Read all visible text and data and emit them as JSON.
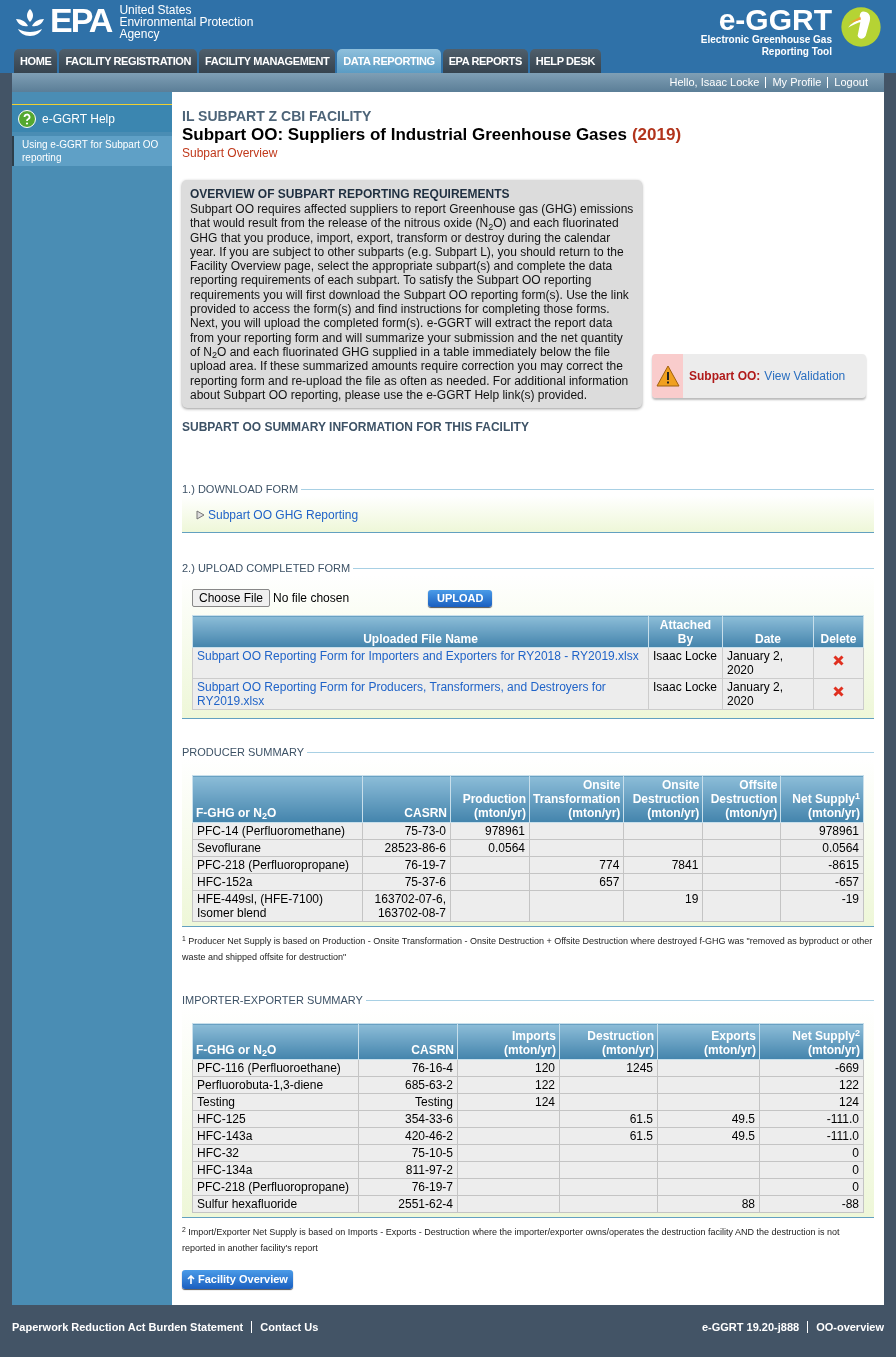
{
  "header": {
    "agency_logo": "EPA",
    "agency_name": [
      "United States",
      "Environmental Protection",
      "Agency"
    ],
    "app_logo": "e-GGRT",
    "app_name": "Electronic Greenhouse Gas Reporting Tool"
  },
  "nav_tabs": [
    {
      "label": "HOME",
      "selected": false
    },
    {
      "label": "FACILITY REGISTRATION",
      "selected": false
    },
    {
      "label": "FACILITY MANAGEMENT",
      "selected": false
    },
    {
      "label": "DATA REPORTING",
      "selected": true
    },
    {
      "label": "EPA REPORTS",
      "selected": false
    },
    {
      "label": "HELP DESK",
      "selected": false
    }
  ],
  "user_links": [
    "Hello, Isaac Locke",
    "My Profile",
    "Logout"
  ],
  "sidebar": {
    "help_title": "e-GGRT Help",
    "items": [
      "Using e-GGRT for Subpart OO reporting"
    ]
  },
  "page": {
    "facility": "IL SUBPART Z CBI FACILITY",
    "title": "Subpart OO: Suppliers of Industrial Greenhouse Gases",
    "year": "(2019)",
    "subtitle": "Subpart Overview"
  },
  "overview": {
    "title": "OVERVIEW OF SUBPART REPORTING REQUIREMENTS",
    "text": "Subpart OO requires affected suppliers to report Greenhouse gas (GHG) emissions that would result from the release of the nitrous oxide (N$_{2}$O) and each fluorinated GHG that you produce, import, export, transform or destroy during the calendar year. If you are subject to other subparts (e.g. Subpart L), you should return to the Facility Overview page, select the appropriate subpart(s) and complete the data reporting requirements of each subpart. To satisfy the Subpart OO reporting requirements you will first download the Subpart OO reporting form(s). Use the link provided to access the form(s) and find instructions for completing those forms. Next, you will upload the completed form(s). e-GGRT will extract the report data from your reporting form and will summarize your submission and the net quantity of N$_{2}$O and each fluorinated GHG supplied in a table immediately below the file upload area. If these summarized amounts require correction you may correct the reporting form and re-upload the file as often as needed. For additional information about Subpart OO reporting, please use the e-GGRT Help link(s) provided."
  },
  "validation": {
    "label": "Subpart OO:",
    "link": "View Validation"
  },
  "summary_heading": "SUBPART OO SUMMARY INFORMATION FOR THIS FACILITY",
  "download": {
    "legend": "1.) DOWNLOAD FORM",
    "link": "Subpart OO GHG Reporting"
  },
  "upload": {
    "legend": "2.) UPLOAD COMPLETED FORM",
    "choose_button": "Choose File",
    "file_status": "No file chosen",
    "upload_button": "UPLOAD",
    "columns": [
      "Uploaded File Name",
      "Attached By",
      "Date",
      "Delete"
    ],
    "rows": [
      {
        "file": "Subpart OO Reporting Form for Importers and Exporters for RY2018 - RY2019.xlsx",
        "attached_by": "Isaac Locke",
        "date": "January 2, 2020"
      },
      {
        "file": "Subpart OO Reporting Form for Producers, Transformers, and Destroyers for RY2019.xlsx",
        "attached_by": "Isaac Locke",
        "date": "January 2, 2020"
      }
    ]
  },
  "producer_summary": {
    "legend": "PRODUCER SUMMARY",
    "columns": [
      "F-GHG or N$_{2}$O",
      "CASRN",
      "Production (mton/yr)",
      "Onsite Transformation (mton/yr)",
      "Onsite Destruction (mton/yr)",
      "Offsite Destruction (mton/yr)",
      "Net Supply$^{1}$ (mton/yr)"
    ],
    "rows": [
      [
        "PFC-14 (Perfluoromethane)",
        "75-73-0",
        "978961",
        "",
        "",
        "",
        "978961"
      ],
      [
        "Sevoflurane",
        "28523-86-6",
        "0.0564",
        "",
        "",
        "",
        "0.0564"
      ],
      [
        "PFC-218 (Perfluoropropane)",
        "76-19-7",
        "",
        "774",
        "7841",
        "",
        "-8615"
      ],
      [
        "HFC-152a",
        "75-37-6",
        "",
        "657",
        "",
        "",
        "-657"
      ],
      [
        "HFE-449sl, (HFE-7100) Isomer blend",
        "163702-07-6, 163702-08-7",
        "",
        "",
        "19",
        "",
        "-19"
      ]
    ],
    "footnote": "$^{1}$ Producer Net Supply is based on Production - Onsite Transformation - Onsite Destruction + Offsite Destruction where destroyed f-GHG was \"removed as byproduct or other waste and shipped offsite for destruction\""
  },
  "importer_summary": {
    "legend": "IMPORTER-EXPORTER SUMMARY",
    "columns": [
      "F-GHG or N$_{2}$O",
      "CASRN",
      "Imports (mton/yr)",
      "Destruction (mton/yr)",
      "Exports (mton/yr)",
      "Net Supply$^{2}$ (mton/yr)"
    ],
    "rows": [
      [
        "PFC-116 (Perfluoroethane)",
        "76-16-4",
        "120",
        "1245",
        "",
        "-669"
      ],
      [
        "Perfluorobuta-1,3-diene",
        "685-63-2",
        "122",
        "",
        "",
        "122"
      ],
      [
        "Testing",
        "Testing",
        "124",
        "",
        "",
        "124"
      ],
      [
        "HFC-125",
        "354-33-6",
        "",
        "61.5",
        "49.5",
        "-111.0"
      ],
      [
        "HFC-143a",
        "420-46-2",
        "",
        "61.5",
        "49.5",
        "-111.0"
      ],
      [
        "HFC-32",
        "75-10-5",
        "",
        "",
        "",
        "0"
      ],
      [
        "HFC-134a",
        "811-97-2",
        "",
        "",
        "",
        "0"
      ],
      [
        "PFC-218 (Perfluoropropane)",
        "76-19-7",
        "",
        "",
        "",
        "0"
      ],
      [
        "Sulfur hexafluoride",
        "2551-62-4",
        "",
        "",
        "88",
        "-88"
      ]
    ],
    "footnote": "$^{2}$ Import/Exporter Net Supply is based on Imports - Exports - Destruction where the importer/exporter owns/operates the destruction facility AND the destruction is not reported in another facility's report"
  },
  "facility_overview_button": "Facility Overview",
  "footer": {
    "left_links": [
      "Paperwork Reduction Act Burden Statement",
      "Contact Us"
    ],
    "right": [
      "e-GGRT 19.20-j888",
      "OO-overview"
    ]
  }
}
